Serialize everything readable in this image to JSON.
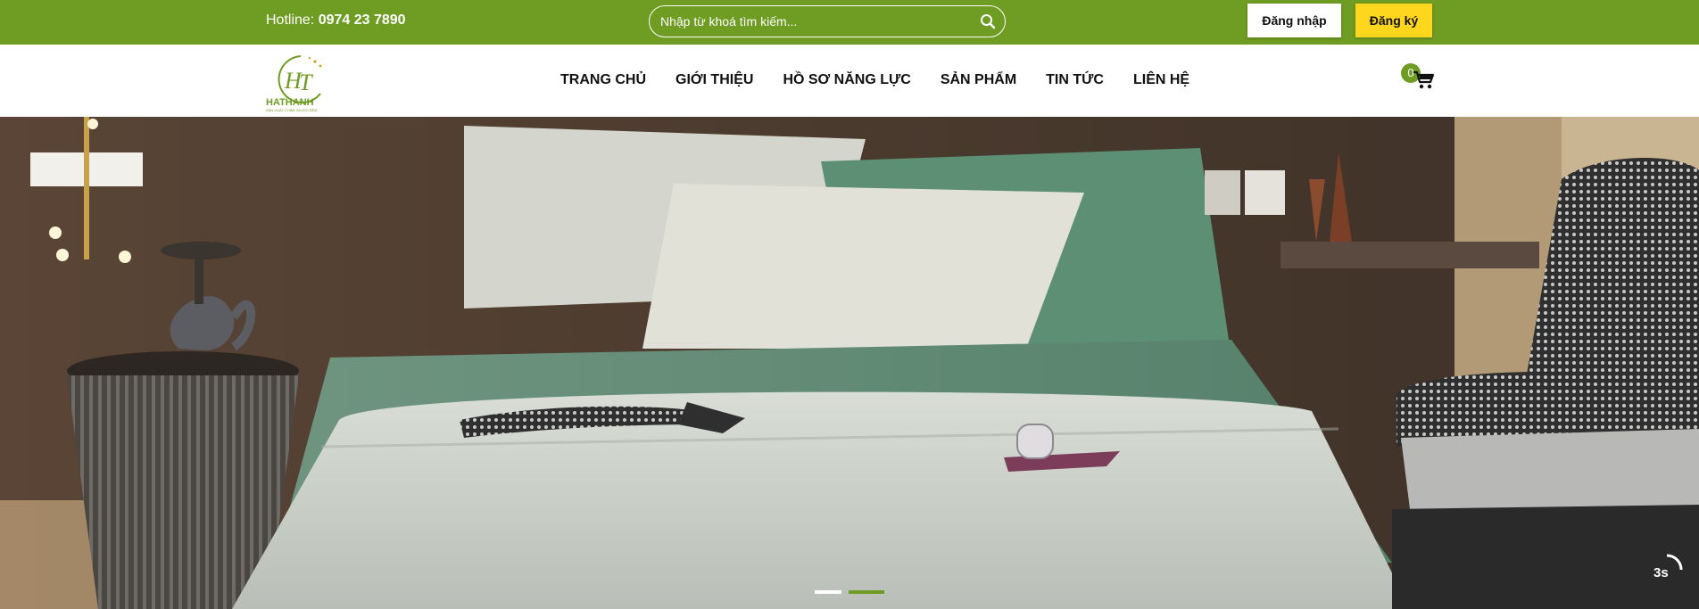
{
  "topbar": {
    "hotline_label": "Hotline:",
    "hotline_number": "0974 23 7890",
    "search_placeholder": "Nhập từ khoá tìm kiếm...",
    "login_label": "Đăng nhập",
    "register_label": "Đăng ký",
    "bg_color": "#6f9c22",
    "register_color": "#ffd61e"
  },
  "header": {
    "logo_text": "HATHANH",
    "logo_tagline": "SẢN XUẤT CHĂN GA GỐI ĐỆM",
    "nav": [
      {
        "label": "TRANG CHỦ"
      },
      {
        "label": "GIỚI THIỆU"
      },
      {
        "label": "HỒ SƠ NĂNG LỰC"
      },
      {
        "label": "SẢN PHẨM"
      },
      {
        "label": "TIN TỨC"
      },
      {
        "label": "LIÊN HỆ"
      }
    ],
    "cart_count": "0"
  },
  "hero": {
    "slide_count": 2,
    "active_slide": 2,
    "autoplay_label": "3s",
    "icons": [
      "search-icon",
      "cart-icon"
    ]
  }
}
